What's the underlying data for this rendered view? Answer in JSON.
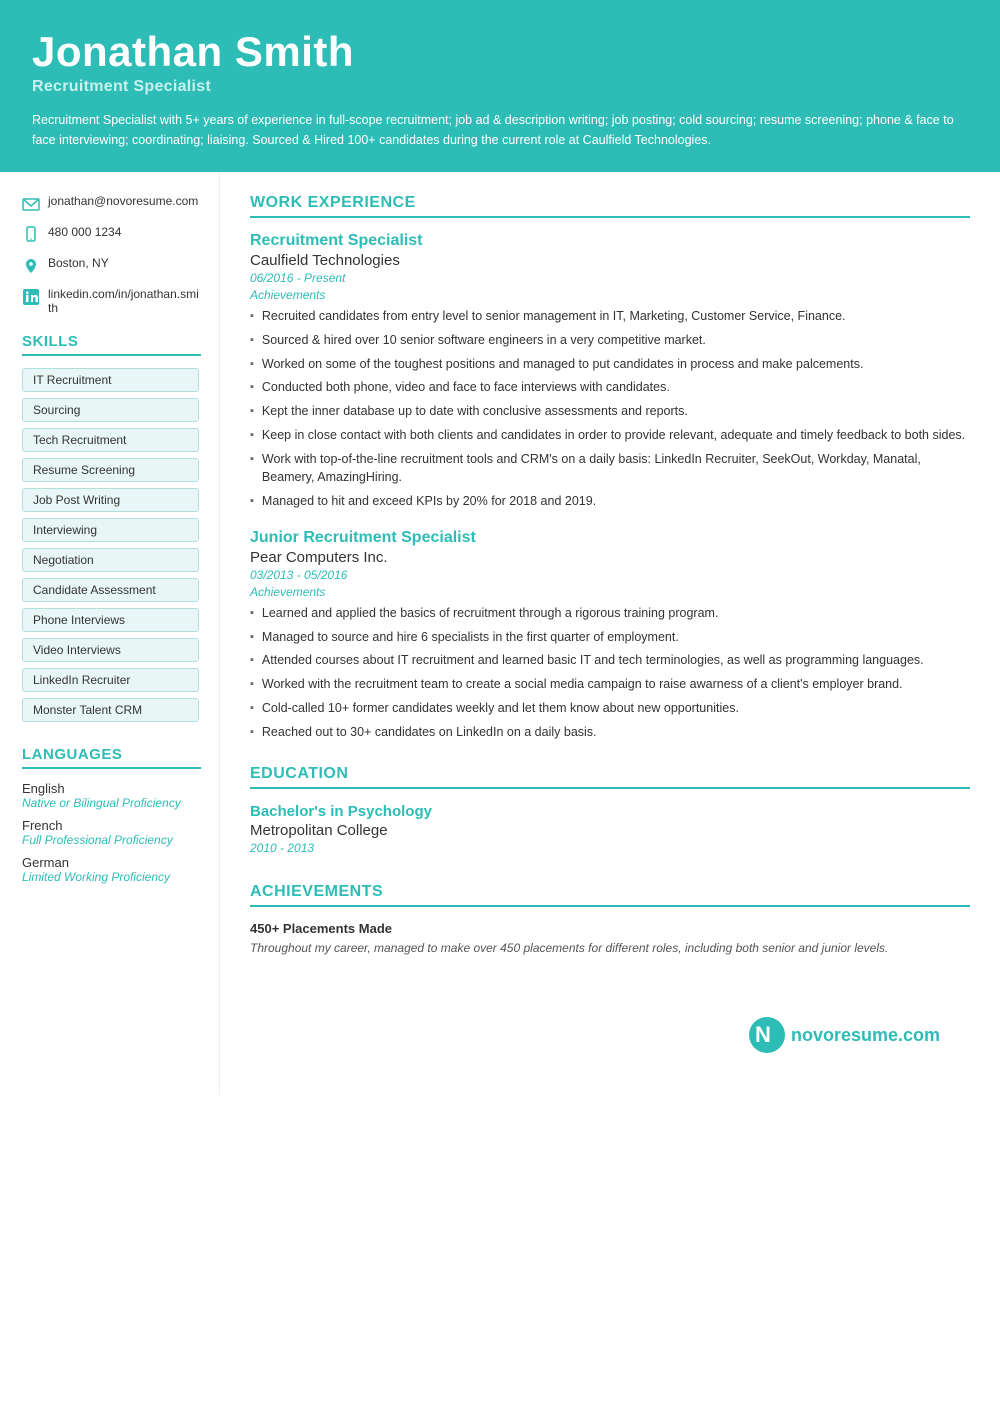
{
  "header": {
    "name": "Jonathan Smith",
    "title": "Recruitment Specialist",
    "summary": "Recruitment Specialist with 5+ years of experience in full-scope recruitment; job ad & description writing; job posting; cold sourcing; resume screening; phone & face to face interviewing; coordinating; liaising. Sourced & Hired 100+ candidates during the current role at Caulfield Technologies."
  },
  "contact": {
    "email": "jonathan@novoresume.com",
    "phone": "480 000 1234",
    "location": "Boston, NY",
    "linkedin": "linkedin.com/in/jonathan.smith"
  },
  "skills": {
    "title": "SKILLS",
    "items": [
      "IT Recruitment",
      "Sourcing",
      "Tech Recruitment",
      "Resume Screening",
      "Job Post Writing",
      "Interviewing",
      "Negotiation",
      "Candidate Assessment",
      "Phone Interviews",
      "Video Interviews",
      "LinkedIn Recruiter",
      "Monster Talent CRM"
    ]
  },
  "languages": {
    "title": "LANGUAGES",
    "items": [
      {
        "name": "English",
        "level": "Native or Bilingual Proficiency"
      },
      {
        "name": "French",
        "level": "Full Professional Proficiency"
      },
      {
        "name": "German",
        "level": "Limited Working Proficiency"
      }
    ]
  },
  "workExperience": {
    "title": "WORK EXPERIENCE",
    "jobs": [
      {
        "title": "Recruitment Specialist",
        "company": "Caulfield Technologies",
        "dates": "06/2016 - Present",
        "achievementsLabel": "Achievements",
        "bullets": [
          "Recruited candidates from entry level to senior management in IT, Marketing, Customer Service, Finance.",
          "Sourced & hired over 10 senior software engineers in a very competitive market.",
          "Worked on some of the toughest positions and managed to put candidates in process and make palcements.",
          "Conducted both phone, video and face to face interviews with candidates.",
          "Kept the inner database up to date with conclusive assessments and reports.",
          "Keep in close contact with both clients and candidates in order to provide relevant, adequate and timely feedback to both sides.",
          "Work with top-of-the-line recruitment tools and CRM's on a daily basis: LinkedIn Recruiter, SeekOut, Workday, Manatal, Beamery, AmazingHiring.",
          "Managed to hit and exceed KPIs by 20% for 2018 and 2019."
        ]
      },
      {
        "title": "Junior Recruitment Specialist",
        "company": "Pear Computers Inc.",
        "dates": "03/2013 - 05/2016",
        "achievementsLabel": "Achievements",
        "bullets": [
          "Learned and applied the basics of recruitment through a rigorous training program.",
          "Managed to source and hire 6 specialists in the first quarter of employment.",
          "Attended courses about IT recruitment and learned basic IT and tech terminologies, as well as programming languages.",
          "Worked with the recruitment team to create a social media campaign to raise awarness of a client's employer brand.",
          "Cold-called 10+ former candidates weekly and let them know about new opportunities.",
          "Reached out to 30+ candidates on LinkedIn on a daily basis."
        ]
      }
    ]
  },
  "education": {
    "title": "EDUCATION",
    "items": [
      {
        "degree": "Bachelor's in Psychology",
        "school": "Metropolitan College",
        "dates": "2010 - 2013"
      }
    ]
  },
  "achievements": {
    "title": "ACHIEVEMENTS",
    "items": [
      {
        "title": "450+ Placements Made",
        "description": "Throughout my career, managed to make over 450 placements for different roles, including both senior and junior levels."
      }
    ]
  },
  "footer": {
    "logo_text": "novoresume.com"
  }
}
